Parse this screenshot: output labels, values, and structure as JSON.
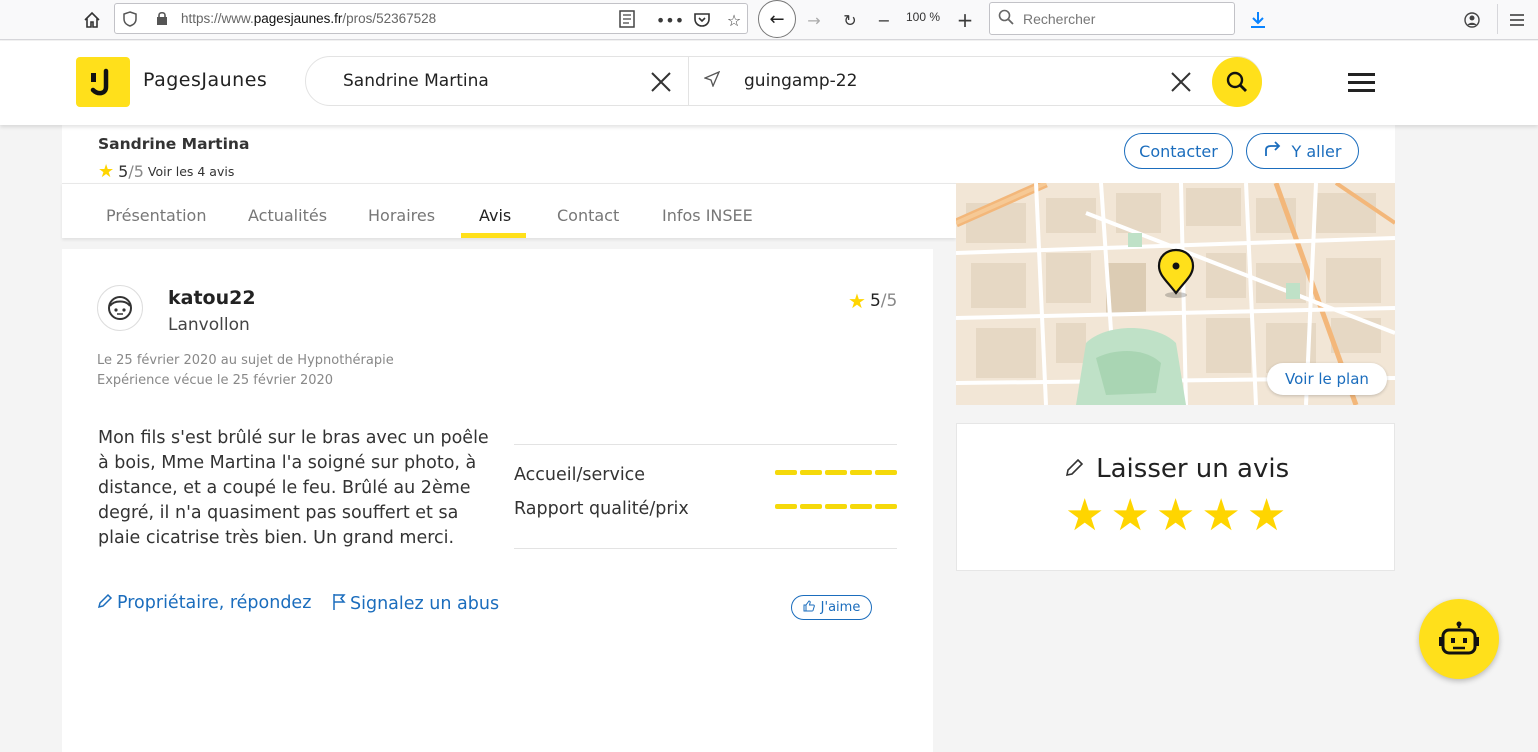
{
  "browser": {
    "url_prefix": "https://www.",
    "url_domain": "pagesjaunes.fr",
    "url_path": "/pros/52367528",
    "zoom": "100 %",
    "search_placeholder": "Rechercher"
  },
  "header": {
    "brand": "PagesJaunes",
    "query": "Sandrine Martina",
    "location": "guingamp-22"
  },
  "pro": {
    "name": "Sandrine Martina",
    "rating": "5",
    "rating_max": "/5",
    "reviews_link": "Voir les 4 avis",
    "contact_label": "Contacter",
    "go_label": "Y aller"
  },
  "tabs": [
    {
      "label": "Présentation"
    },
    {
      "label": "Actualités"
    },
    {
      "label": "Horaires"
    },
    {
      "label": "Avis"
    },
    {
      "label": "Contact"
    },
    {
      "label": "Infos INSEE"
    }
  ],
  "map": {
    "button": "Voir le plan"
  },
  "review": {
    "user": "katou22",
    "city": "Lanvollon",
    "rating": "5",
    "rating_max": "/5",
    "date_line": "Le 25 février 2020 au sujet de Hypnothérapie",
    "experience_line": "Expérience vécue le 25 février 2020",
    "text": "Mon fils s'est brûlé sur le bras avec un poêle à bois, Mme Martina l'a soigné sur photo, à distance, et a coupé le feu. Brûlé au 2ème degré, il n'a quasiment pas souffert et sa plaie cicatrise très bien. Un grand merci.",
    "criteria": [
      {
        "label": "Accueil/service",
        "score": 5,
        "max": 5
      },
      {
        "label": "Rapport qualité/prix",
        "score": 5,
        "max": 5
      }
    ],
    "reply_label": "Propriétaire, répondez",
    "report_label": "Signalez un abus",
    "like_label": "J'aime"
  },
  "leave_review": {
    "title": "Laisser un avis",
    "stars": 5
  },
  "colors": {
    "brand_yellow": "#ffe01b",
    "link_blue": "#1b6dbd",
    "star_yellow": "#ffd500"
  }
}
